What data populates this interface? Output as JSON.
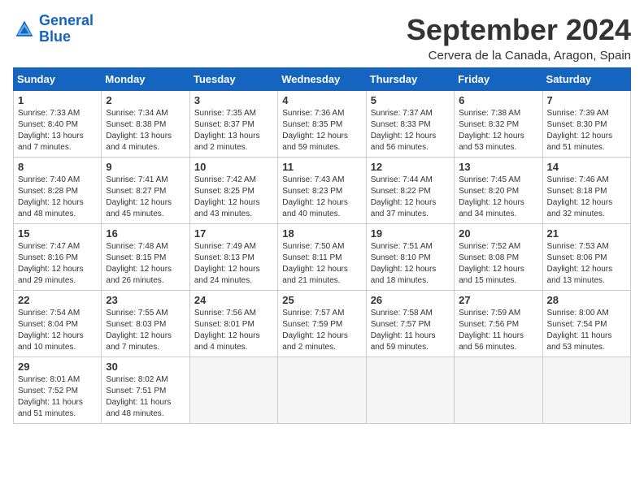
{
  "header": {
    "logo_line1": "General",
    "logo_line2": "Blue",
    "title": "September 2024",
    "location": "Cervera de la Canada, Aragon, Spain"
  },
  "columns": [
    "Sunday",
    "Monday",
    "Tuesday",
    "Wednesday",
    "Thursday",
    "Friday",
    "Saturday"
  ],
  "weeks": [
    [
      {
        "day": 1,
        "rise": "7:33 AM",
        "set": "8:40 PM",
        "daylight": "13 hours and 7 minutes."
      },
      {
        "day": 2,
        "rise": "7:34 AM",
        "set": "8:38 PM",
        "daylight": "13 hours and 4 minutes."
      },
      {
        "day": 3,
        "rise": "7:35 AM",
        "set": "8:37 PM",
        "daylight": "13 hours and 2 minutes."
      },
      {
        "day": 4,
        "rise": "7:36 AM",
        "set": "8:35 PM",
        "daylight": "12 hours and 59 minutes."
      },
      {
        "day": 5,
        "rise": "7:37 AM",
        "set": "8:33 PM",
        "daylight": "12 hours and 56 minutes."
      },
      {
        "day": 6,
        "rise": "7:38 AM",
        "set": "8:32 PM",
        "daylight": "12 hours and 53 minutes."
      },
      {
        "day": 7,
        "rise": "7:39 AM",
        "set": "8:30 PM",
        "daylight": "12 hours and 51 minutes."
      }
    ],
    [
      {
        "day": 8,
        "rise": "7:40 AM",
        "set": "8:28 PM",
        "daylight": "12 hours and 48 minutes."
      },
      {
        "day": 9,
        "rise": "7:41 AM",
        "set": "8:27 PM",
        "daylight": "12 hours and 45 minutes."
      },
      {
        "day": 10,
        "rise": "7:42 AM",
        "set": "8:25 PM",
        "daylight": "12 hours and 43 minutes."
      },
      {
        "day": 11,
        "rise": "7:43 AM",
        "set": "8:23 PM",
        "daylight": "12 hours and 40 minutes."
      },
      {
        "day": 12,
        "rise": "7:44 AM",
        "set": "8:22 PM",
        "daylight": "12 hours and 37 minutes."
      },
      {
        "day": 13,
        "rise": "7:45 AM",
        "set": "8:20 PM",
        "daylight": "12 hours and 34 minutes."
      },
      {
        "day": 14,
        "rise": "7:46 AM",
        "set": "8:18 PM",
        "daylight": "12 hours and 32 minutes."
      }
    ],
    [
      {
        "day": 15,
        "rise": "7:47 AM",
        "set": "8:16 PM",
        "daylight": "12 hours and 29 minutes."
      },
      {
        "day": 16,
        "rise": "7:48 AM",
        "set": "8:15 PM",
        "daylight": "12 hours and 26 minutes."
      },
      {
        "day": 17,
        "rise": "7:49 AM",
        "set": "8:13 PM",
        "daylight": "12 hours and 24 minutes."
      },
      {
        "day": 18,
        "rise": "7:50 AM",
        "set": "8:11 PM",
        "daylight": "12 hours and 21 minutes."
      },
      {
        "day": 19,
        "rise": "7:51 AM",
        "set": "8:10 PM",
        "daylight": "12 hours and 18 minutes."
      },
      {
        "day": 20,
        "rise": "7:52 AM",
        "set": "8:08 PM",
        "daylight": "12 hours and 15 minutes."
      },
      {
        "day": 21,
        "rise": "7:53 AM",
        "set": "8:06 PM",
        "daylight": "12 hours and 13 minutes."
      }
    ],
    [
      {
        "day": 22,
        "rise": "7:54 AM",
        "set": "8:04 PM",
        "daylight": "12 hours and 10 minutes."
      },
      {
        "day": 23,
        "rise": "7:55 AM",
        "set": "8:03 PM",
        "daylight": "12 hours and 7 minutes."
      },
      {
        "day": 24,
        "rise": "7:56 AM",
        "set": "8:01 PM",
        "daylight": "12 hours and 4 minutes."
      },
      {
        "day": 25,
        "rise": "7:57 AM",
        "set": "7:59 PM",
        "daylight": "12 hours and 2 minutes."
      },
      {
        "day": 26,
        "rise": "7:58 AM",
        "set": "7:57 PM",
        "daylight": "11 hours and 59 minutes."
      },
      {
        "day": 27,
        "rise": "7:59 AM",
        "set": "7:56 PM",
        "daylight": "11 hours and 56 minutes."
      },
      {
        "day": 28,
        "rise": "8:00 AM",
        "set": "7:54 PM",
        "daylight": "11 hours and 53 minutes."
      }
    ],
    [
      {
        "day": 29,
        "rise": "8:01 AM",
        "set": "7:52 PM",
        "daylight": "11 hours and 51 minutes."
      },
      {
        "day": 30,
        "rise": "8:02 AM",
        "set": "7:51 PM",
        "daylight": "11 hours and 48 minutes."
      },
      null,
      null,
      null,
      null,
      null
    ]
  ]
}
